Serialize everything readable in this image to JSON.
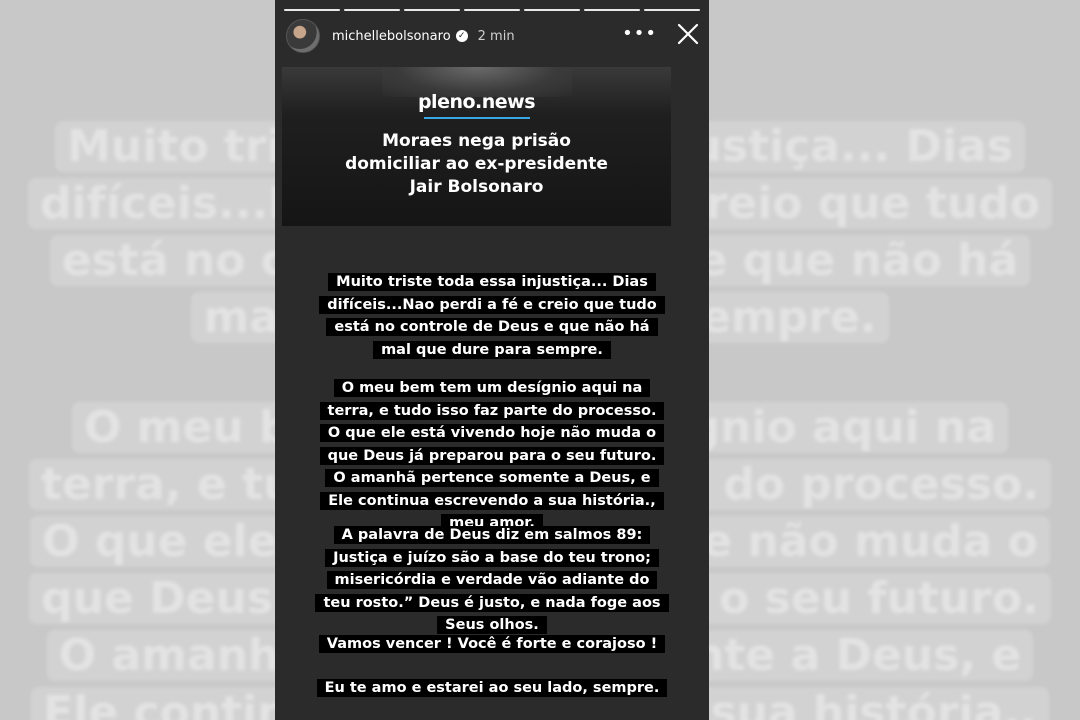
{
  "background": {
    "block_a": "Muito triste toda essa injustiça... Dias\ndifíceis...Nao perdi a fé e creio que tudo\nestá no controle de Deus e que não há\nmal que dure para sempre.",
    "block_b": "O meu bem tem um desígnio aqui na\nterra, e tudo isso faz parte do processo.\nO que ele está vivendo hoje não muda o\nque Deus já preparou para o seu futuro.\nO amanhã pertence somente a Deus, e\nEle continua escrevendo a sua história.,"
  },
  "story": {
    "segments_total": 7,
    "segments_done": 7,
    "username": "michellebolsonaro",
    "verified_glyph": "✓",
    "time": "2 min",
    "more_glyph": "•••",
    "icons": {
      "avatar": "avatar-image",
      "verified": "verified-badge-icon",
      "more": "more-options-icon",
      "close": "close-icon"
    }
  },
  "news_card": {
    "brand": "pleno.news",
    "brand_accent": "#3aa8e6",
    "headline": "Moraes nega prisão\ndomiciliar ao ex-presidente\nJair Bolsonaro"
  },
  "caption": {
    "p1": "Muito triste toda essa injustiça... Dias\ndifíceis...Nao perdi a fé e creio que tudo\nestá no controle de Deus e que não há\nmal que dure para sempre.",
    "p2": "O meu bem tem um desígnio aqui na\nterra, e tudo isso faz parte do processo.\nO que ele está vivendo hoje não muda o\nque Deus já preparou para o seu futuro.\nO amanhã pertence somente a Deus, e\nEle continua escrevendo a sua história.,\nmeu amor.",
    "p3": "A palavra de Deus diz em salmos 89:\nJustiça e juízo são a base do teu trono;\nmisericórdia e verdade vão adiante do\nteu rosto.” Deus é justo, e nada foge aos\nSeus olhos.",
    "p4": "Vamos vencer ! Você é forte e corajoso !",
    "p5": "Eu te amo e estarei ao seu lado, sempre."
  }
}
